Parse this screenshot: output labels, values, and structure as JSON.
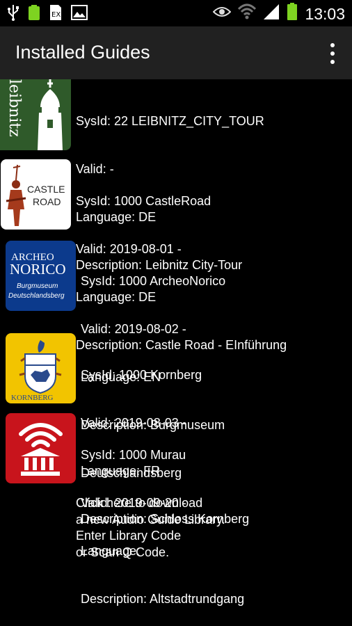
{
  "status_bar": {
    "time": "13:03",
    "left_icons": [
      "usb-icon",
      "battery-app-icon",
      "sd-card-icon",
      "image-icon"
    ],
    "right_icons": [
      "eye-icon",
      "wifi-icon",
      "signal-icon",
      "battery-icon"
    ]
  },
  "action_bar": {
    "title": "Installed Guides",
    "menu_icon": "overflow-menu-icon"
  },
  "guides": [
    {
      "sysid": "SysId: 22 LEIBNITZ_CITY_TOUR",
      "valid": "Valid:  -",
      "language": "Language: DE",
      "description": "Description: Leibnitz City-Tour",
      "logo_text": "leibnitz"
    },
    {
      "sysid": "SysId: 1000 CastleRoad",
      "valid": "Valid: 2019-08-01 -",
      "language": "Language: DE",
      "description": "Description: Castle Road - EInführung",
      "logo_text_1": "CASTLE",
      "logo_text_2": "ROAD"
    },
    {
      "sysid": "SysId: 1000 ArcheoNorico",
      "valid": "Valid: 2019-08-02 -",
      "language": "Language: EN",
      "description": "Description: Burgmuseum",
      "description_2": "Deutschlandsberg",
      "logo_text_1": "ARCHEO",
      "logo_text_2": "NORICO",
      "logo_text_3": "Burgmuseum",
      "logo_text_4": "Deutschlandsberg"
    },
    {
      "sysid": "SysId: 1000 Kornberg",
      "valid": "Valid: 2019-08-03 -",
      "language": "Language: FR",
      "description": "Description: Schloss Kornberg",
      "logo_text": "KORNBERG"
    },
    {
      "sysid": "SysId: 1000 Murau",
      "valid": "Valid: 2019-09-20 -",
      "language": "Language:",
      "description": "Description: Altstadtrundgang"
    }
  ],
  "download": {
    "line1": "Click here to download",
    "line2": "a new Audio Guide Library.",
    "line3": "Enter Library Code",
    "line4": "or Scan Q Code."
  }
}
